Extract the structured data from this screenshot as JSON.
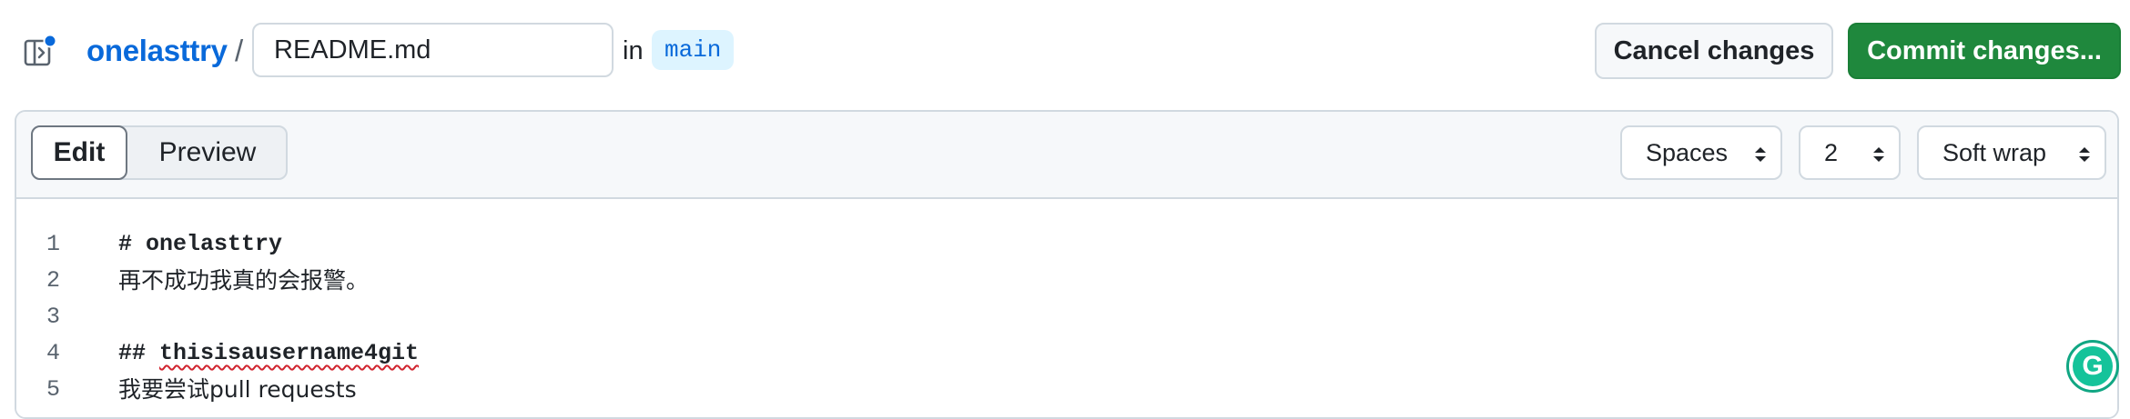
{
  "header": {
    "repo_name": "onelasttry",
    "separator": "/",
    "filename": "README.md",
    "in_label": "in",
    "branch": "main",
    "cancel_label": "Cancel changes",
    "commit_label": "Commit changes..."
  },
  "editor": {
    "tabs": [
      {
        "label": "Edit",
        "active": true
      },
      {
        "label": "Preview",
        "active": false
      }
    ],
    "indent_mode": "Spaces",
    "indent_size": "2",
    "wrap_mode": "Soft wrap",
    "lines": [
      {
        "number": "1",
        "text": "# onelasttry"
      },
      {
        "number": "2",
        "text": "再不成功我真的会报警。"
      },
      {
        "number": "3",
        "text": ""
      },
      {
        "number": "4",
        "prefix": "## ",
        "text": "thisisausername4git"
      },
      {
        "number": "5",
        "text": "我要尝试pull requests"
      }
    ]
  },
  "extensions": {
    "grammarly_icon": "grammarly-icon",
    "grammarly_letter": "G"
  },
  "colors": {
    "link": "#0969da",
    "commit_green": "#1f883d",
    "branch_bg": "#ddf4ff",
    "spellcheck": "#d1242f"
  }
}
